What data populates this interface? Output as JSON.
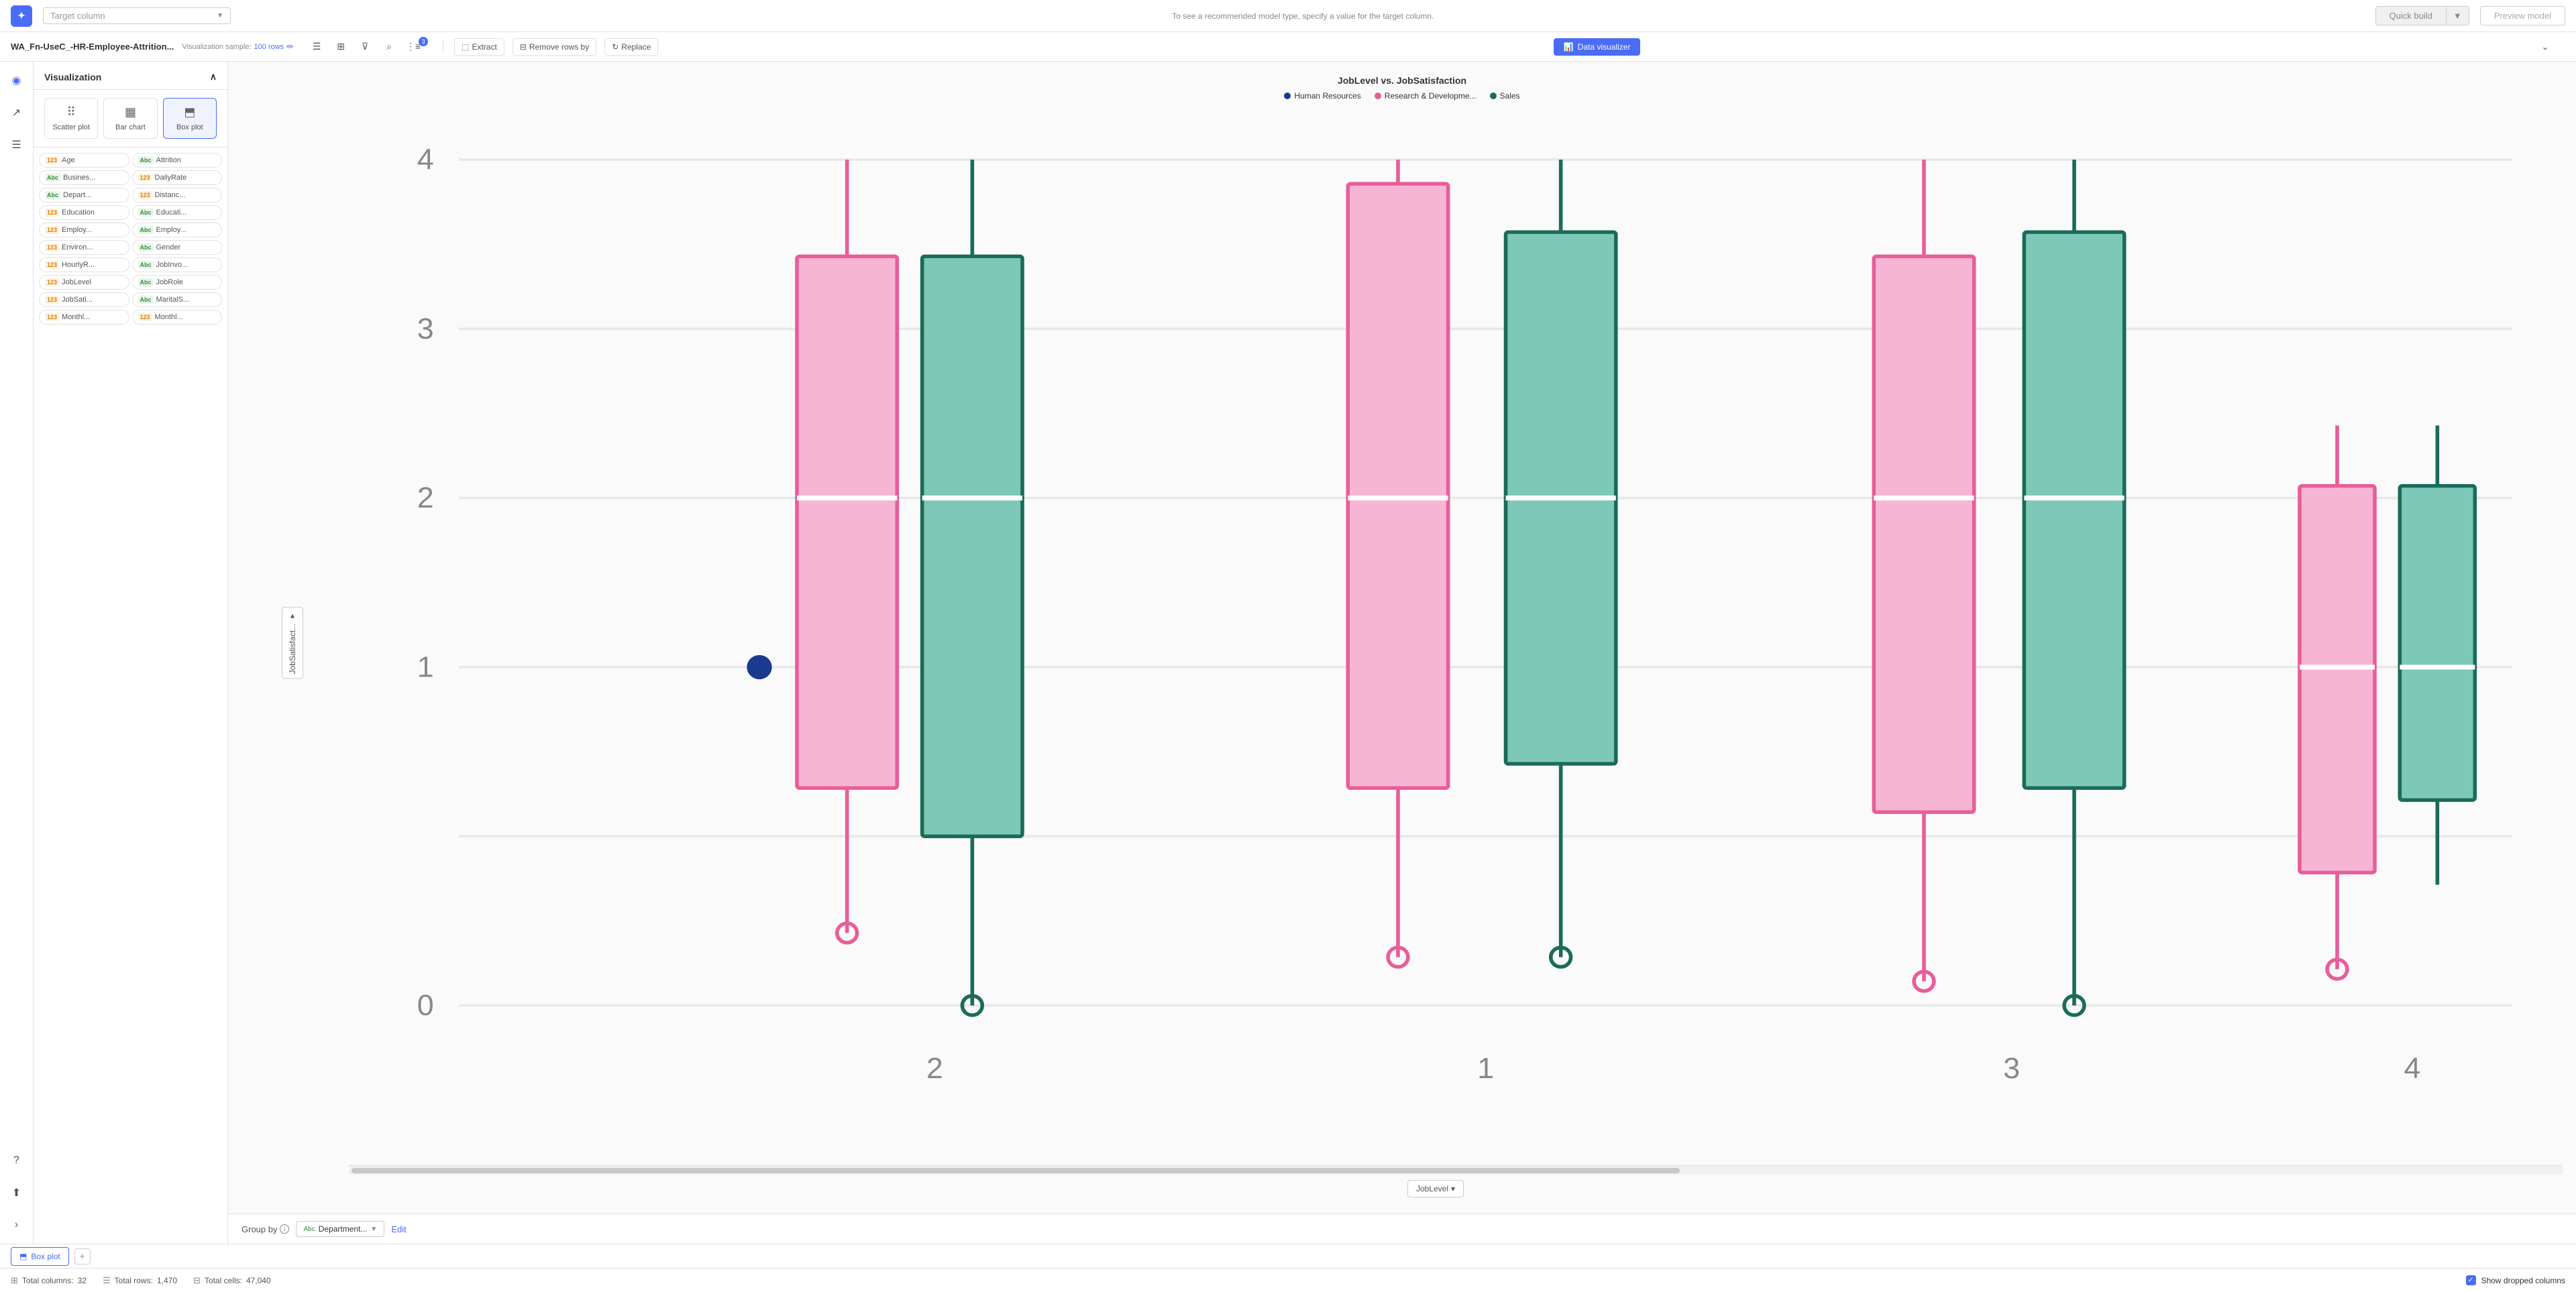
{
  "topbar": {
    "target_column_placeholder": "Target column",
    "hint_text": "To see a recommended model type, specify a value for the target column.",
    "quick_build_label": "Quick build",
    "preview_model_label": "Preview model"
  },
  "secondary_bar": {
    "file_name": "WA_Fn-UseC_-HR-Employee-Attrition...",
    "sample_label": "Visualization sample:",
    "sample_count": "100 rows",
    "toolbar": {
      "extract_label": "Extract",
      "remove_rows_label": "Remove rows by",
      "replace_label": "Replace",
      "data_visualizer_label": "Data visualizer"
    },
    "badge_count": "3"
  },
  "viz_panel": {
    "title": "Visualization",
    "types": [
      {
        "id": "scatter",
        "label": "Scatter plot",
        "icon": "⠿"
      },
      {
        "id": "bar",
        "label": "Bar chart",
        "icon": "▦"
      },
      {
        "id": "box",
        "label": "Box plot",
        "icon": "⬒"
      }
    ],
    "fields": [
      {
        "name": "Age",
        "type": "123"
      },
      {
        "name": "Attrition",
        "type": "Abc"
      },
      {
        "name": "Busines...",
        "type": "Abc"
      },
      {
        "name": "DailyRate",
        "type": "123"
      },
      {
        "name": "Depart...",
        "type": "Abc"
      },
      {
        "name": "Distanc...",
        "type": "123"
      },
      {
        "name": "Education",
        "type": "123"
      },
      {
        "name": "Educati...",
        "type": "Abc"
      },
      {
        "name": "Employ...",
        "type": "123"
      },
      {
        "name": "Employ...",
        "type": "Abc"
      },
      {
        "name": "Environ...",
        "type": "123"
      },
      {
        "name": "Gender",
        "type": "Abc"
      },
      {
        "name": "HourlyR...",
        "type": "123"
      },
      {
        "name": "JobInvo...",
        "type": "Abc"
      },
      {
        "name": "JobLevel",
        "type": "123"
      },
      {
        "name": "JobRole",
        "type": "Abc"
      },
      {
        "name": "JobSati...",
        "type": "123"
      },
      {
        "name": "MaritalS...",
        "type": "Abc"
      },
      {
        "name": "Monthl...",
        "type": "123"
      },
      {
        "name": "Monthl...",
        "type": "123"
      }
    ]
  },
  "chart": {
    "title": "JobLevel vs. JobSatisfaction",
    "legend": [
      {
        "label": "Human Resources",
        "color": "#1a3a8f"
      },
      {
        "label": "Research & Developme...",
        "color": "#e85d9a"
      },
      {
        "label": "Sales",
        "color": "#1a6b5a"
      }
    ],
    "y_axis_label": "JobSatisfact...",
    "x_axis_label": "JobLevel",
    "y_ticks": [
      "4",
      "3",
      "2",
      "1",
      "0"
    ],
    "x_ticks": [
      "2",
      "1",
      "3",
      "4"
    ]
  },
  "groupby": {
    "label": "Group by",
    "value": "Department...",
    "edit_label": "Edit"
  },
  "active_tab": {
    "icon": "⬒",
    "label": "Box plot"
  },
  "footer": {
    "total_columns_label": "Total columns:",
    "total_columns_value": "32",
    "total_rows_label": "Total rows:",
    "total_rows_value": "1,470",
    "total_cells_label": "Total cells:",
    "total_cells_value": "47,040",
    "show_dropped_label": "Show dropped columns"
  },
  "detection": {
    "education_text": "123 Education"
  }
}
